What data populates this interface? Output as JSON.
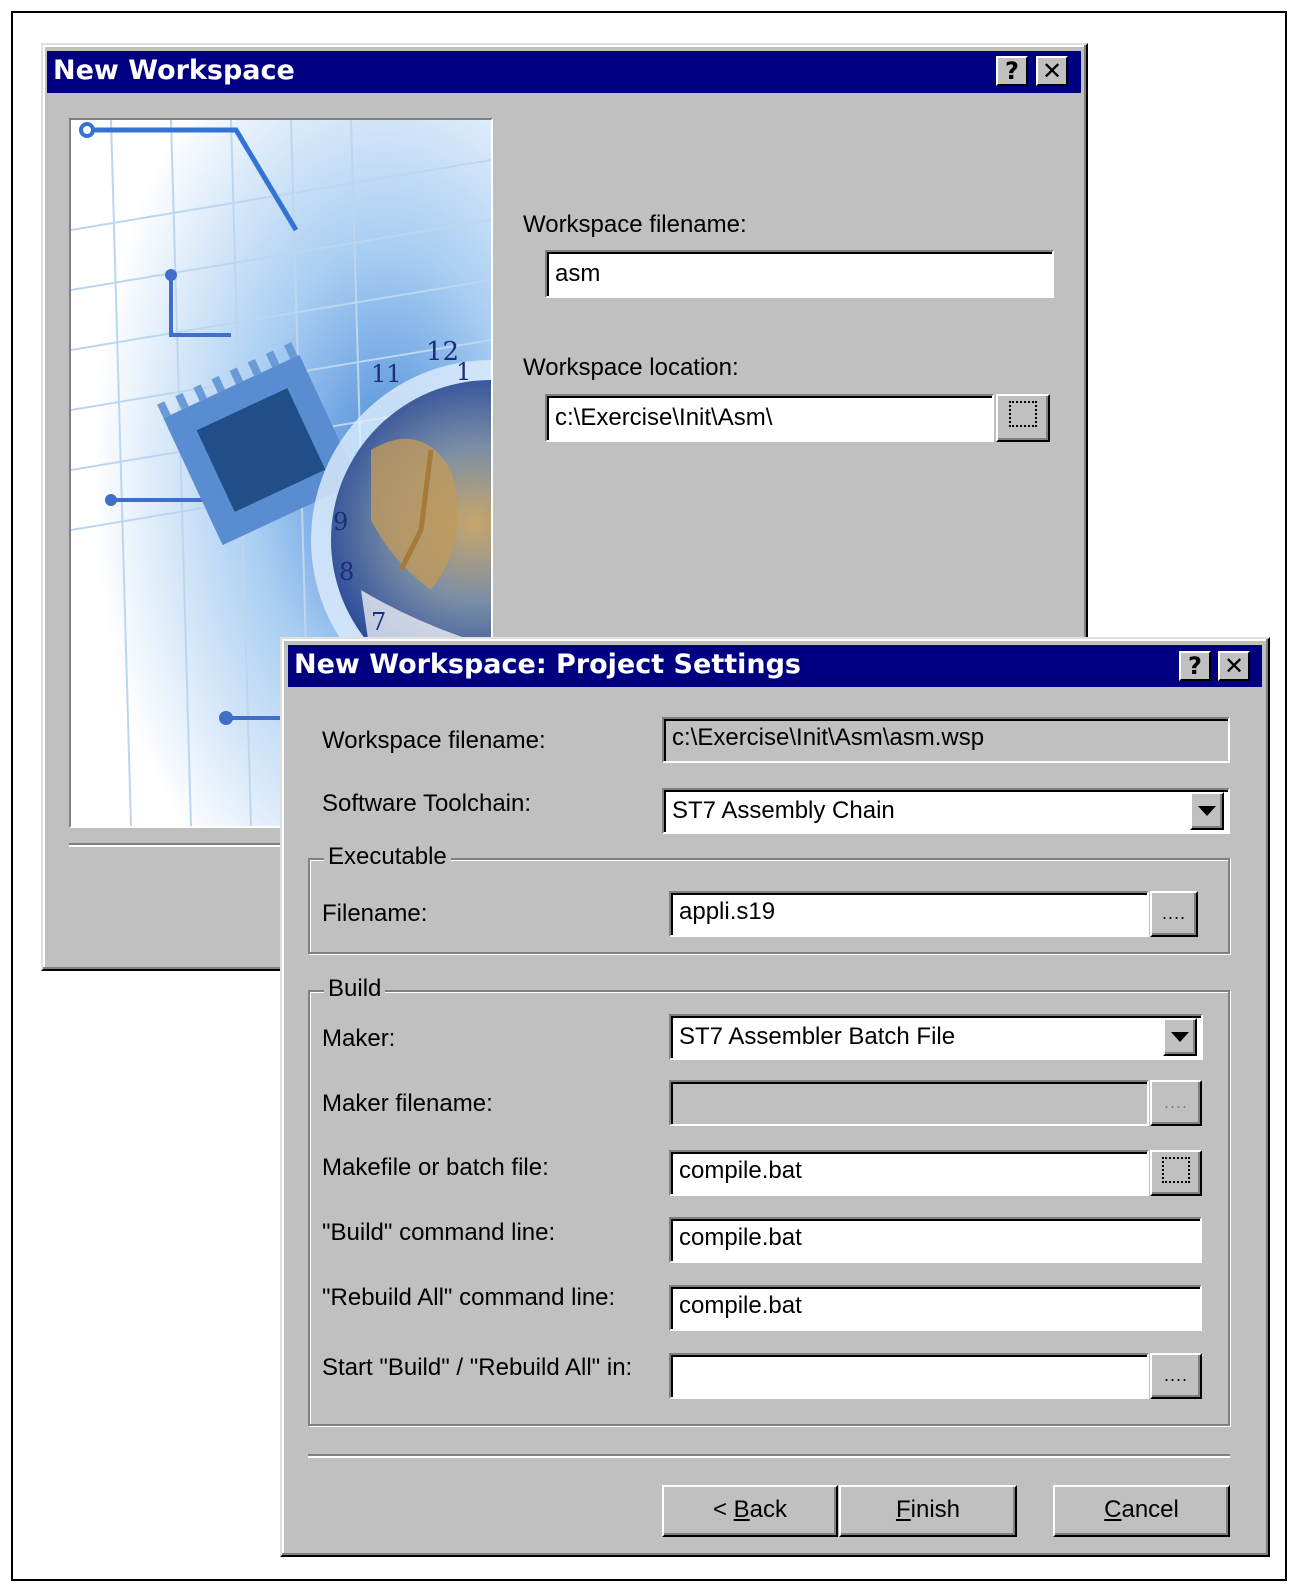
{
  "back_window": {
    "title": "New Workspace",
    "help_label": "?",
    "close_label": "✕",
    "workspace_filename_label": "Workspace filename:",
    "workspace_filename_value": "asm",
    "workspace_location_label": "Workspace location:",
    "workspace_location_value": "c:\\Exercise\\Init\\Asm\\"
  },
  "front_window": {
    "title": "New Workspace: Project Settings",
    "help_label": "?",
    "close_label": "✕",
    "workspace_filename_label": "Workspace filename:",
    "workspace_filename_value": "c:\\Exercise\\Init\\Asm\\asm.wsp",
    "toolchain_label": "Software Toolchain:",
    "toolchain_value": "ST7 Assembly Chain",
    "executable_group": {
      "title": "Executable",
      "filename_label": "Filename:",
      "filename_value": "appli.s19",
      "browse_label": "...."
    },
    "build_group": {
      "title": "Build",
      "maker_label": "Maker:",
      "maker_value": "ST7 Assembler Batch File",
      "maker_filename_label": "Maker filename:",
      "maker_filename_value": "",
      "makefile_label": "Makefile or batch file:",
      "makefile_value": "compile.bat",
      "build_cmd_label": "\"Build\" command line:",
      "build_cmd_value": "compile.bat",
      "rebuild_cmd_label": "\"Rebuild All\" command line:",
      "rebuild_cmd_value": "compile.bat",
      "start_in_label": "Start \"Build\" / \"Rebuild All\" in:",
      "start_in_value": "",
      "browse_label": "...."
    },
    "buttons": {
      "back_prefix": "< ",
      "back_mnemonic": "B",
      "back_rest": "ack",
      "finish_mnemonic": "F",
      "finish_rest": "inish",
      "cancel_mnemonic": "C",
      "cancel_rest": "ancel"
    }
  }
}
